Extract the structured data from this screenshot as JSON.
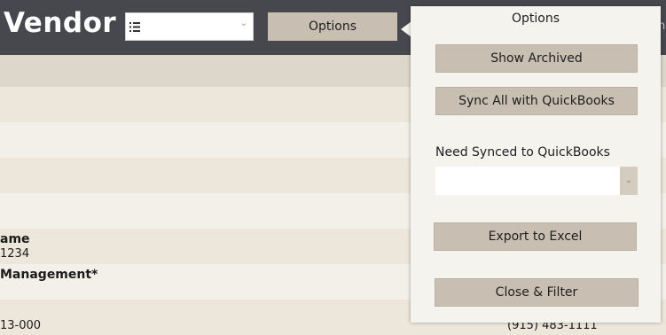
{
  "header": {
    "title": "Vendor",
    "options_label": "Options",
    "edge_text": "n"
  },
  "table": {
    "rows": [
      {
        "bold": "ame",
        "text": "1234"
      },
      {
        "bold": "Management*",
        "text": ""
      },
      {
        "bold": "",
        "text": "13-000",
        "right": "(915) 483-1111"
      }
    ]
  },
  "popup": {
    "title": "Options",
    "show_archived": "Show Archived",
    "sync_all": "Sync All with QuickBooks",
    "need_synced_label": "Need Synced to QuickBooks",
    "need_synced_value": "",
    "export": "Export to Excel",
    "close_filter": "Close & Filter"
  },
  "colors": {
    "header_bg": "#47484d",
    "button_bg": "#c8bfb2",
    "row_alt": "#ece6db",
    "row_base": "#f3f0e9"
  },
  "icons": [
    "list-icon",
    "chevron-down-icon"
  ]
}
